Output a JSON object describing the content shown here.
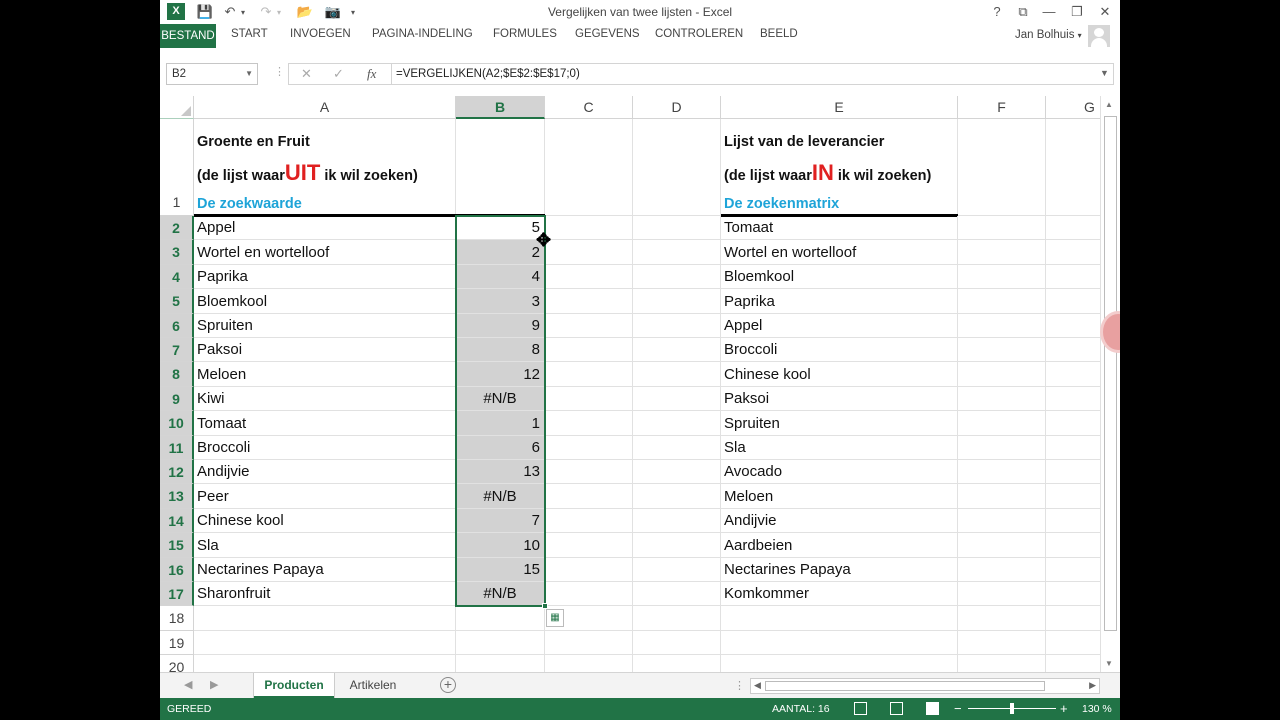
{
  "window": {
    "title": "Vergelijken van twee lijsten - Excel",
    "logo": "X",
    "help": "?",
    "ribbon_display": "⧉",
    "minimize": "—",
    "restore": "❐",
    "close": "✕"
  },
  "quick_access": {
    "save_icon": "💾",
    "undo_icon": "↶",
    "redo_icon": "↷",
    "open_icon": "📂",
    "camera_icon": "📷",
    "customize_icon": "▾"
  },
  "ribbon": {
    "tabs": [
      "BESTAND",
      "START",
      "INVOEGEN",
      "PAGINA-INDELING",
      "FORMULES",
      "GEGEVENS",
      "CONTROLEREN",
      "BEELD"
    ],
    "user": "Jan Bolhuis"
  },
  "formula_bar": {
    "name_box": "B2",
    "cancel": "✕",
    "enter": "✓",
    "fx": "fx",
    "formula": "=VERGELIJKEN(A2;$E$2:$E$17;0)"
  },
  "columns": [
    "A",
    "B",
    "C",
    "D",
    "E",
    "F",
    "G"
  ],
  "header_block": {
    "left_title": "Groente en Fruit",
    "left_sub_pre": "(de lijst waar",
    "left_sub_big": "UIT",
    "left_sub_post": " ik wil zoeken)",
    "left_blue": "De zoekwaarde",
    "right_title": "Lijst van de leverancier",
    "right_sub_pre": "(de lijst waar",
    "right_sub_big": "IN",
    "right_sub_post": " ik wil zoeken)",
    "right_blue": "De zoekenmatrix"
  },
  "rows": [
    {
      "n": "2",
      "a": "Appel",
      "b": "5",
      "e": "Tomaat"
    },
    {
      "n": "3",
      "a": "Wortel en wortelloof",
      "b": "2",
      "e": "Wortel en wortelloof"
    },
    {
      "n": "4",
      "a": "Paprika",
      "b": "4",
      "e": "Bloemkool"
    },
    {
      "n": "5",
      "a": "Bloemkool",
      "b": "3",
      "e": "Paprika"
    },
    {
      "n": "6",
      "a": "Spruiten",
      "b": "9",
      "e": "Appel"
    },
    {
      "n": "7",
      "a": "Paksoi",
      "b": "8",
      "e": "Broccoli"
    },
    {
      "n": "8",
      "a": "Meloen",
      "b": "12",
      "e": "Chinese kool"
    },
    {
      "n": "9",
      "a": "Kiwi",
      "b": "#N/B",
      "e": "Paksoi"
    },
    {
      "n": "10",
      "a": "Tomaat",
      "b": "1",
      "e": "Spruiten"
    },
    {
      "n": "11",
      "a": "Broccoli",
      "b": "6",
      "e": "Sla"
    },
    {
      "n": "12",
      "a": "Andijvie",
      "b": "13",
      "e": "Avocado"
    },
    {
      "n": "13",
      "a": "Peer",
      "b": "#N/B",
      "e": "Meloen"
    },
    {
      "n": "14",
      "a": "Chinese kool",
      "b": "7",
      "e": "Andijvie"
    },
    {
      "n": "15",
      "a": "Sla",
      "b": "10",
      "e": "Aardbeien"
    },
    {
      "n": "16",
      "a": "Nectarines Papaya",
      "b": "15",
      "e": "Nectarines Papaya"
    },
    {
      "n": "17",
      "a": "Sharonfruit",
      "b": "#N/B",
      "e": "Komkommer"
    },
    {
      "n": "18",
      "a": "",
      "b": "",
      "e": ""
    },
    {
      "n": "19",
      "a": "",
      "b": "",
      "e": ""
    },
    {
      "n": "20",
      "a": "",
      "b": "",
      "e": ""
    }
  ],
  "row1_label": "1",
  "sheets": {
    "active": "Producten",
    "other": "Artikelen",
    "add": "+",
    "nav_left": "◀",
    "nav_right": "▶",
    "dots": "⋮"
  },
  "status": {
    "ready": "GEREED",
    "count": "AANTAL: 16",
    "zoom_minus": "−",
    "zoom_plus": "+",
    "zoom": "130 %",
    "zoom_fraction": 0.5
  },
  "colors": {
    "excel_green": "#217346",
    "highlight_red": "#e02020",
    "label_blue": "#1ea4d8",
    "selection_fill": "#d2d2d2"
  }
}
